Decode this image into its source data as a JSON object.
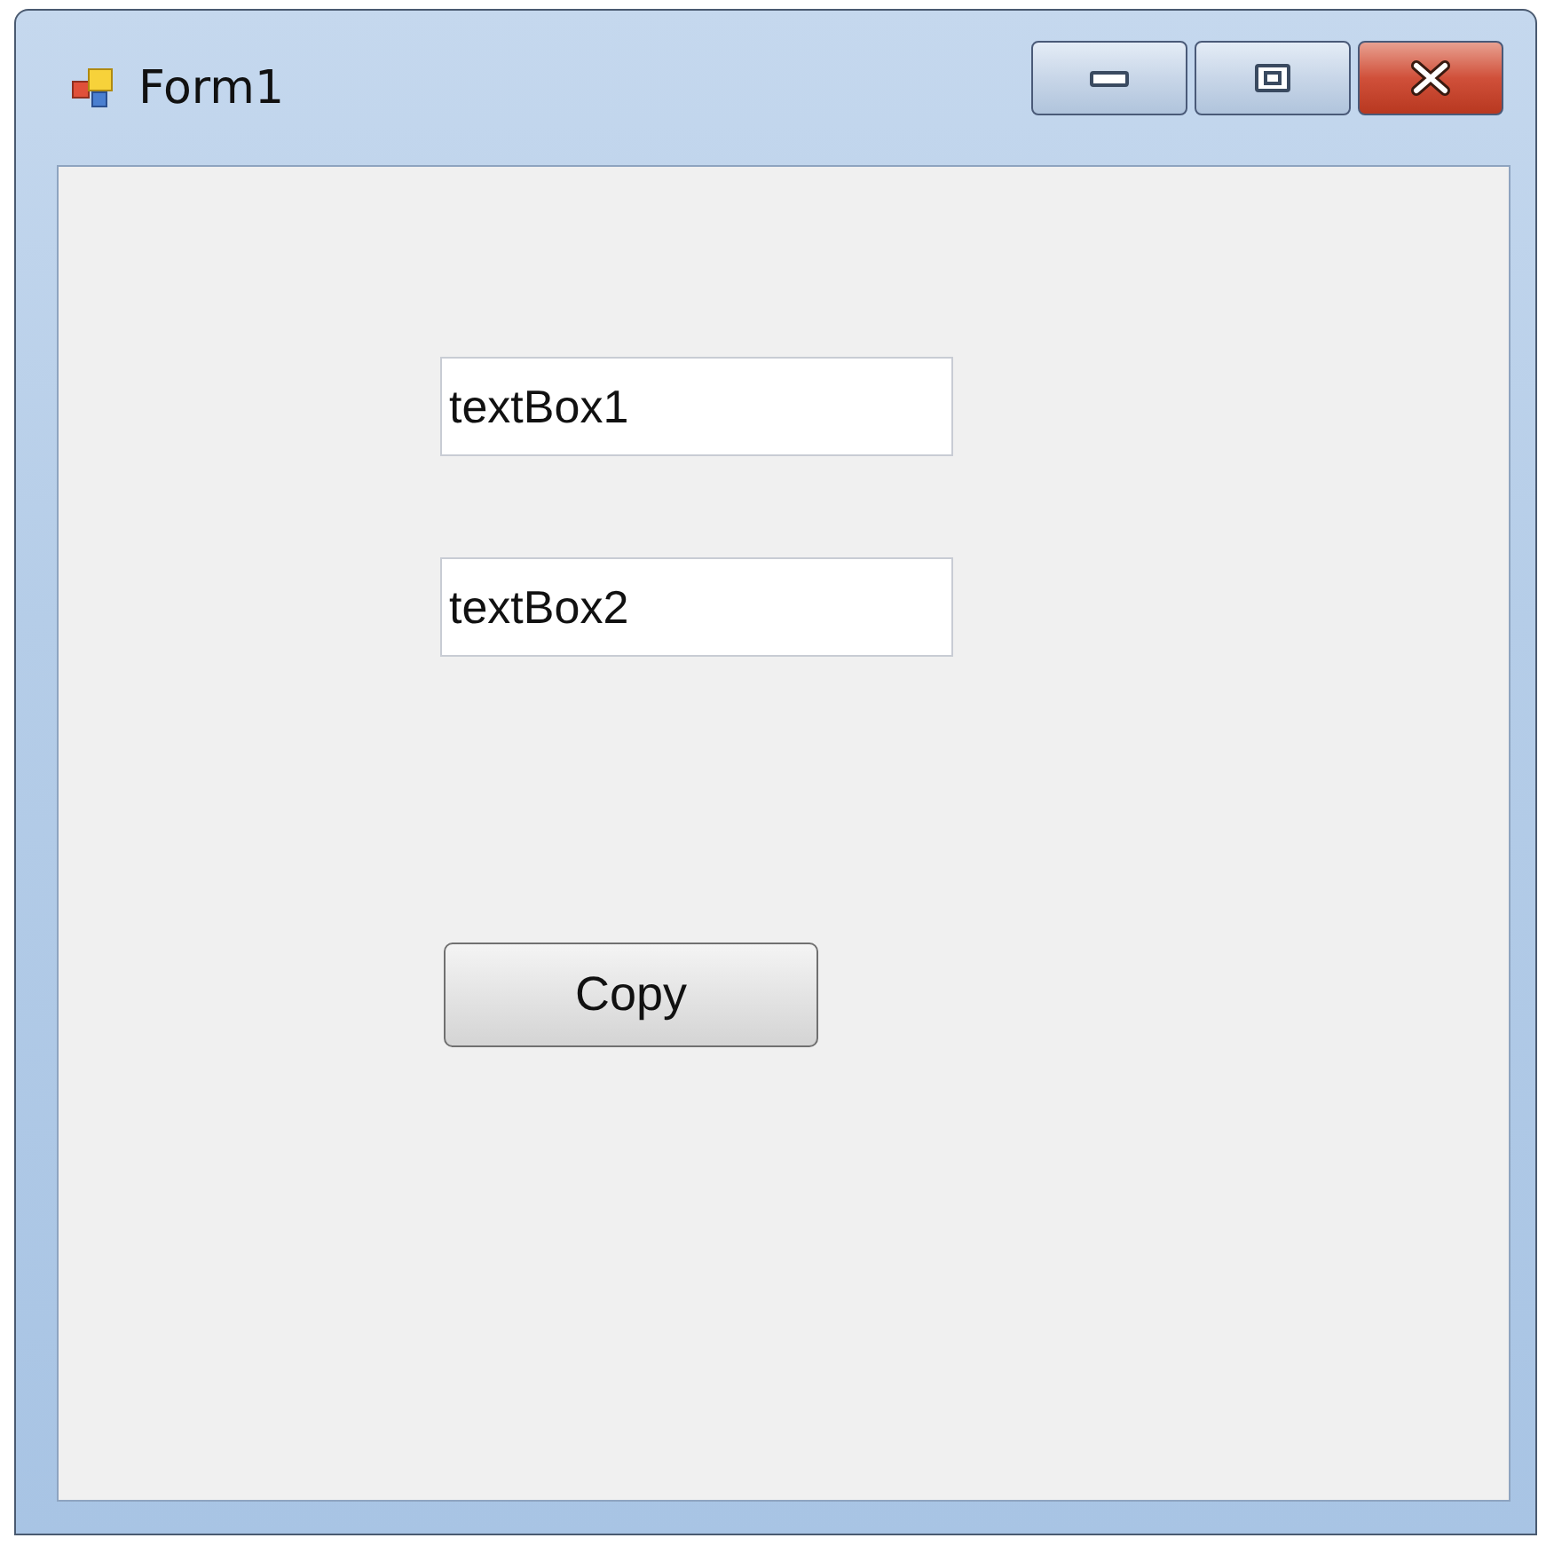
{
  "window": {
    "title": "Form1"
  },
  "text_boxes": [
    {
      "value": "textBox1"
    },
    {
      "value": "textBox2"
    }
  ],
  "button": {
    "label": "Copy"
  }
}
